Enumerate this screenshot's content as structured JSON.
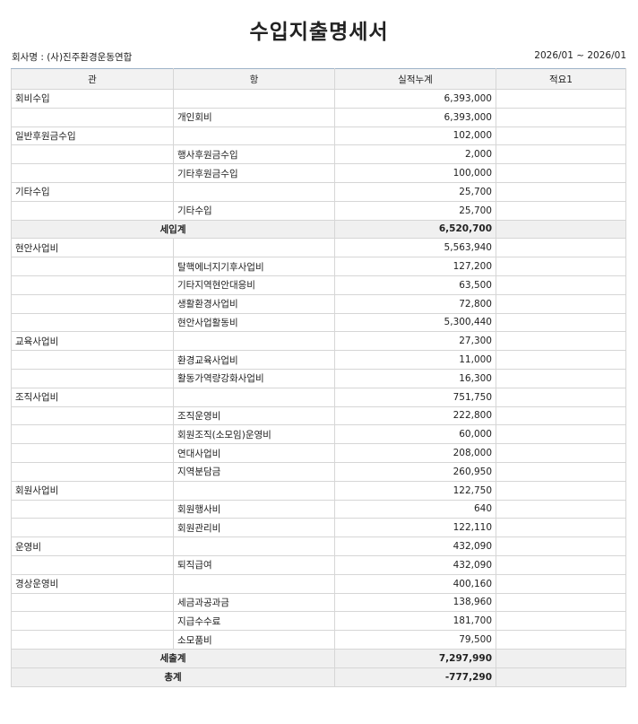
{
  "title": "수입지출명세서",
  "company": "회사명 : (사)진주환경운동연합",
  "period": "2026/01 ~ 2026/01",
  "columns": [
    "관",
    "항",
    "실적누계",
    "적요1"
  ],
  "rows": [
    {
      "type": "item",
      "gwan": "회비수입",
      "hang": "",
      "amount": "6,393,000",
      "memo": ""
    },
    {
      "type": "item",
      "gwan": "",
      "hang": "개인회비",
      "amount": "6,393,000",
      "memo": ""
    },
    {
      "type": "item",
      "gwan": "일반후원금수입",
      "hang": "",
      "amount": "102,000",
      "memo": ""
    },
    {
      "type": "item",
      "gwan": "",
      "hang": "행사후원금수입",
      "amount": "2,000",
      "memo": ""
    },
    {
      "type": "item",
      "gwan": "",
      "hang": "기타후원금수입",
      "amount": "100,000",
      "memo": ""
    },
    {
      "type": "item",
      "gwan": "기타수입",
      "hang": "",
      "amount": "25,700",
      "memo": ""
    },
    {
      "type": "item",
      "gwan": "",
      "hang": "기타수입",
      "amount": "25,700",
      "memo": ""
    },
    {
      "type": "total",
      "label": "세입계",
      "amount": "6,520,700",
      "memo": ""
    },
    {
      "type": "item",
      "gwan": "현안사업비",
      "hang": "",
      "amount": "5,563,940",
      "memo": ""
    },
    {
      "type": "item",
      "gwan": "",
      "hang": "탈핵에너지기후사업비",
      "amount": "127,200",
      "memo": ""
    },
    {
      "type": "item",
      "gwan": "",
      "hang": "기타지역현안대응비",
      "amount": "63,500",
      "memo": ""
    },
    {
      "type": "item",
      "gwan": "",
      "hang": "생활환경사업비",
      "amount": "72,800",
      "memo": ""
    },
    {
      "type": "item",
      "gwan": "",
      "hang": "현안사업활동비",
      "amount": "5,300,440",
      "memo": ""
    },
    {
      "type": "item",
      "gwan": "교육사업비",
      "hang": "",
      "amount": "27,300",
      "memo": ""
    },
    {
      "type": "item",
      "gwan": "",
      "hang": "환경교육사업비",
      "amount": "11,000",
      "memo": ""
    },
    {
      "type": "item",
      "gwan": "",
      "hang": "활동가역량강화사업비",
      "amount": "16,300",
      "memo": ""
    },
    {
      "type": "item",
      "gwan": "조직사업비",
      "hang": "",
      "amount": "751,750",
      "memo": ""
    },
    {
      "type": "item",
      "gwan": "",
      "hang": "조직운영비",
      "amount": "222,800",
      "memo": ""
    },
    {
      "type": "item",
      "gwan": "",
      "hang": "회원조직(소모임)운영비",
      "amount": "60,000",
      "memo": ""
    },
    {
      "type": "item",
      "gwan": "",
      "hang": "연대사업비",
      "amount": "208,000",
      "memo": ""
    },
    {
      "type": "item",
      "gwan": "",
      "hang": "지역분담금",
      "amount": "260,950",
      "memo": ""
    },
    {
      "type": "item",
      "gwan": "회원사업비",
      "hang": "",
      "amount": "122,750",
      "memo": ""
    },
    {
      "type": "item",
      "gwan": "",
      "hang": "회원행사비",
      "amount": "640",
      "memo": ""
    },
    {
      "type": "item",
      "gwan": "",
      "hang": "회원관리비",
      "amount": "122,110",
      "memo": ""
    },
    {
      "type": "item",
      "gwan": "운영비",
      "hang": "",
      "amount": "432,090",
      "memo": ""
    },
    {
      "type": "item",
      "gwan": "",
      "hang": "퇴직급여",
      "amount": "432,090",
      "memo": ""
    },
    {
      "type": "item",
      "gwan": "경상운영비",
      "hang": "",
      "amount": "400,160",
      "memo": ""
    },
    {
      "type": "item",
      "gwan": "",
      "hang": "세금과공과금",
      "amount": "138,960",
      "memo": ""
    },
    {
      "type": "item",
      "gwan": "",
      "hang": "지급수수료",
      "amount": "181,700",
      "memo": ""
    },
    {
      "type": "item",
      "gwan": "",
      "hang": "소모품비",
      "amount": "79,500",
      "memo": ""
    },
    {
      "type": "total",
      "label": "세출계",
      "amount": "7,297,990",
      "memo": ""
    },
    {
      "type": "total",
      "label": "총계",
      "amount": "-777,290",
      "memo": ""
    }
  ]
}
